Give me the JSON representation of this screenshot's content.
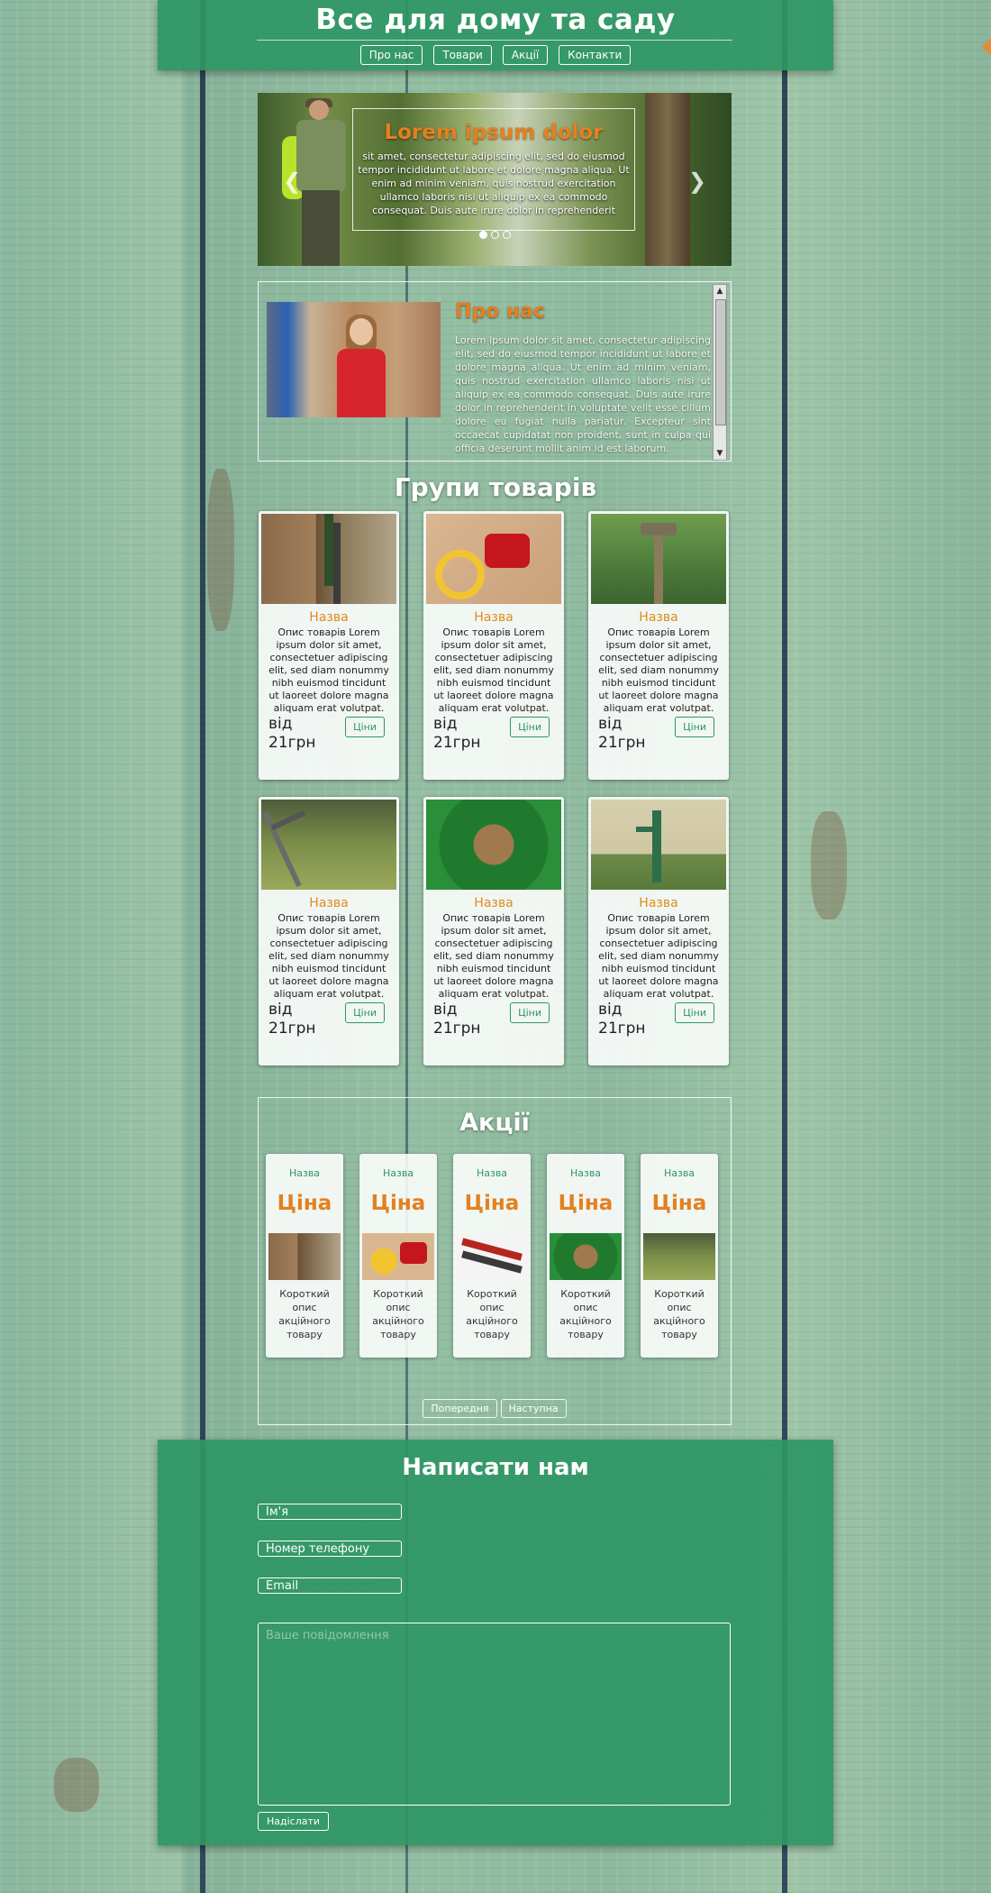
{
  "header": {
    "title": "Все для дому та саду",
    "nav": [
      "Про нас",
      "Товари",
      "Акції",
      "Контакти"
    ]
  },
  "slider": {
    "heading": "Lorem ipsum dolor",
    "text": "sit amet, consectetur adipiscing elit, sed do eiusmod tempor incididunt ut labore et dolore magna aliqua. Ut enim ad minim veniam, quis nostrud exercitation ullamco laboris nisi ut aliquip ex ea commodo consequat. Duis aute irure dolor in reprehenderit",
    "prev_icon": "chevron-left-icon",
    "next_icon": "chevron-right-icon",
    "dots": 3,
    "active_dot": 1
  },
  "about": {
    "heading": "Про нас",
    "text": "Lorem ipsum dolor sit amet, consectetur adipiscing elit, sed do eiusmod tempor incididunt ut labore et dolore magna aliqua. Ut enim ad minim veniam, quis nostrud exercitation ullamco laboris nisi ut aliquip ex ea commodo consequat. Duis aute irure dolor in reprehenderit in voluptate velit esse cillum dolore eu fugiat nulla pariatur. Excepteur sint occaecat cupidatat non proident, sunt in culpa qui officia deserunt mollit anim id est laborum."
  },
  "products": {
    "title": "Групи товарів",
    "items": [
      {
        "name": "Назва",
        "desc": "Опис товарів Lorem ipsum dolor sit amet, consectetuer adipiscing elit, sed diam nonummy nibh euismod tincidunt ut laoreet dolore magna aliquam erat volutpat.",
        "price": "від\n21грн",
        "button": "Ціни",
        "image": "garden-tools"
      },
      {
        "name": "Назва",
        "desc": "Опис товарів Lorem ipsum dolor sit amet, consectetuer adipiscing elit, sed diam nonummy nibh euismod tincidunt ut laoreet dolore magna aliquam erat volutpat.",
        "price": "від\n21грн",
        "button": "Ціни",
        "image": "air-compressor"
      },
      {
        "name": "Назва",
        "desc": "Опис товарів Lorem ipsum dolor sit amet, consectetuer adipiscing elit, sed diam nonummy nibh euismod tincidunt ut laoreet dolore magna aliquam erat volutpat.",
        "price": "від\n21грн",
        "button": "Ціни",
        "image": "sprinkler"
      },
      {
        "name": "Назва",
        "desc": "Опис товарів Lorem ipsum dolor sit amet, consectetuer adipiscing elit, sed diam nonummy nibh euismod tincidunt ut laoreet dolore magna aliquam erat volutpat.",
        "price": "від\n21грн",
        "button": "Ціни",
        "image": "rake"
      },
      {
        "name": "Назва",
        "desc": "Опис товарів Lorem ipsum dolor sit amet, consectetuer adipiscing elit, sed diam nonummy nibh euismod tincidunt ut laoreet dolore magna aliquam erat volutpat.",
        "price": "від\n21грн",
        "button": "Ціни",
        "image": "hose-reel"
      },
      {
        "name": "Назва",
        "desc": "Опис товарів Lorem ipsum dolor sit amet, consectetuer adipiscing elit, sed diam nonummy nibh euismod tincidunt ut laoreet dolore magna aliquam erat volutpat.",
        "price": "від\n21грн",
        "button": "Ціни",
        "image": "water-pump"
      }
    ]
  },
  "promo": {
    "title": "Акції",
    "items": [
      {
        "name": "Назва",
        "price": "Ціна",
        "desc": "Короткий опис акційного товару",
        "image": "garden-tools"
      },
      {
        "name": "Назва",
        "price": "Ціна",
        "desc": "Короткий опис акційного товару",
        "image": "air-compressor"
      },
      {
        "name": "Назва",
        "price": "Ціна",
        "desc": "Короткий опис акційного товару",
        "image": "pruning-shears"
      },
      {
        "name": "Назва",
        "price": "Ціна",
        "desc": "Короткий опис акційного товару",
        "image": "hose-reel"
      },
      {
        "name": "Назва",
        "price": "Ціна",
        "desc": "Короткий опис акційного товару",
        "image": "rake"
      }
    ],
    "prev": "Попередня",
    "next": "Наступна"
  },
  "contact": {
    "title": "Написати нам",
    "name_placeholder": "Ім'я",
    "phone_placeholder": "Номер телефону",
    "email_placeholder": "Email",
    "message_placeholder": "Ваше повідомлення",
    "send": "Надіслати"
  },
  "colors": {
    "brand_green": "#2e9664",
    "accent_orange": "#e4801f",
    "wood_base": "#95bfa3",
    "plank_line": "#1f2e45"
  }
}
